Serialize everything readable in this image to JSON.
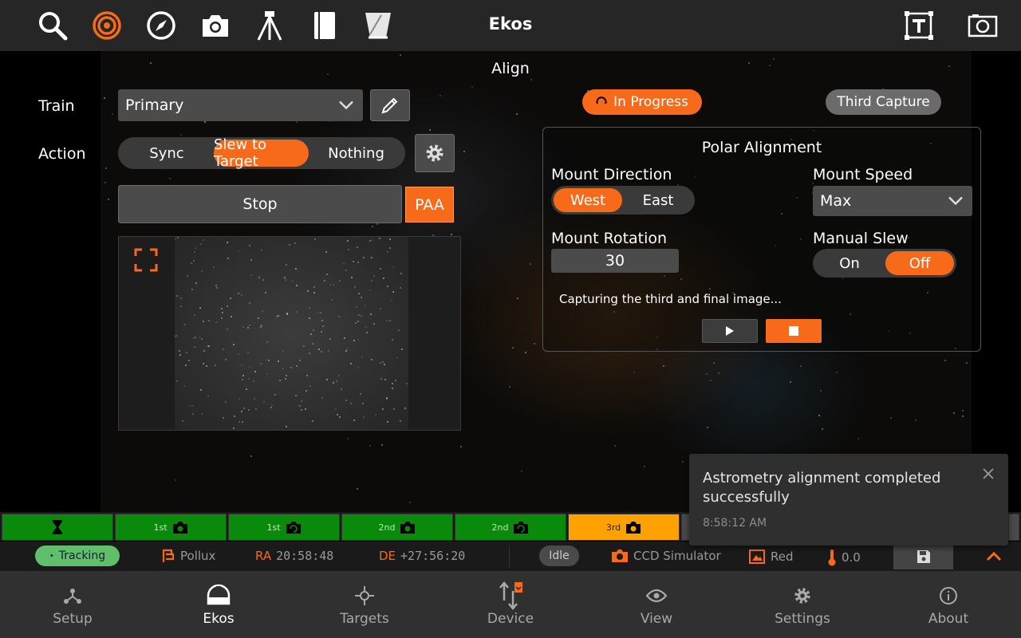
{
  "app": {
    "title": "Ekos"
  },
  "toolbar": {
    "icons": [
      "search-icon",
      "target-icon",
      "compass-icon",
      "camera-icon",
      "tripod-icon",
      "notebook-icon",
      "flat-panel-icon",
      "text-box-icon",
      "fits-viewer-icon"
    ]
  },
  "align": {
    "page_title": "Align",
    "train_label": "Train",
    "train_value": "Primary",
    "action_label": "Action",
    "actions": [
      "Sync",
      "Slew to Target",
      "Nothing"
    ],
    "selected_action": "Slew to Target",
    "stop_label": "Stop",
    "paa_label": "PAA"
  },
  "status_pills": {
    "progress": "In Progress",
    "stage": "Third Capture"
  },
  "polar": {
    "title": "Polar Alignment",
    "mount_direction_label": "Mount Direction",
    "directions": [
      "West",
      "East"
    ],
    "selected_direction": "West",
    "mount_speed_label": "Mount Speed",
    "mount_speed_value": "Max",
    "mount_rotation_label": "Mount Rotation",
    "mount_rotation_value": "30",
    "manual_slew_label": "Manual Slew",
    "manual_slew_options": [
      "On",
      "Off"
    ],
    "manual_slew_selected": "Off",
    "status": "Capturing the third and final image..."
  },
  "toast": {
    "message": "Astrometry alignment completed successfully",
    "time": "8:58:12 AM"
  },
  "steps": [
    {
      "label": "",
      "icon": "hourglass-icon",
      "state": "done"
    },
    {
      "label": "1st",
      "icon": "camera-icon",
      "state": "done"
    },
    {
      "label": "1st",
      "icon": "rotate-icon",
      "state": "done"
    },
    {
      "label": "2nd",
      "icon": "camera-icon",
      "state": "done"
    },
    {
      "label": "2nd",
      "icon": "rotate-icon",
      "state": "done"
    },
    {
      "label": "3rd",
      "icon": "camera-icon",
      "state": "active"
    }
  ],
  "statusbar": {
    "tracking": "Tracking",
    "target": "Pollux",
    "ra_label": "RA",
    "ra_value": "20:58:48",
    "de_label": "DE",
    "de_value": "+27:56:20",
    "idle": "Idle",
    "camera": "CCD Simulator",
    "filter": "Red",
    "temperature": "0.0"
  },
  "nav": {
    "items": [
      "Setup",
      "Ekos",
      "Targets",
      "Device",
      "View",
      "Settings",
      "About"
    ],
    "active": "Ekos"
  },
  "colors": {
    "accent": "#f66a1a",
    "done_step": "#0a8a0a",
    "active_step": "#ffa100",
    "tracking_pill": "#5fbf6a"
  }
}
